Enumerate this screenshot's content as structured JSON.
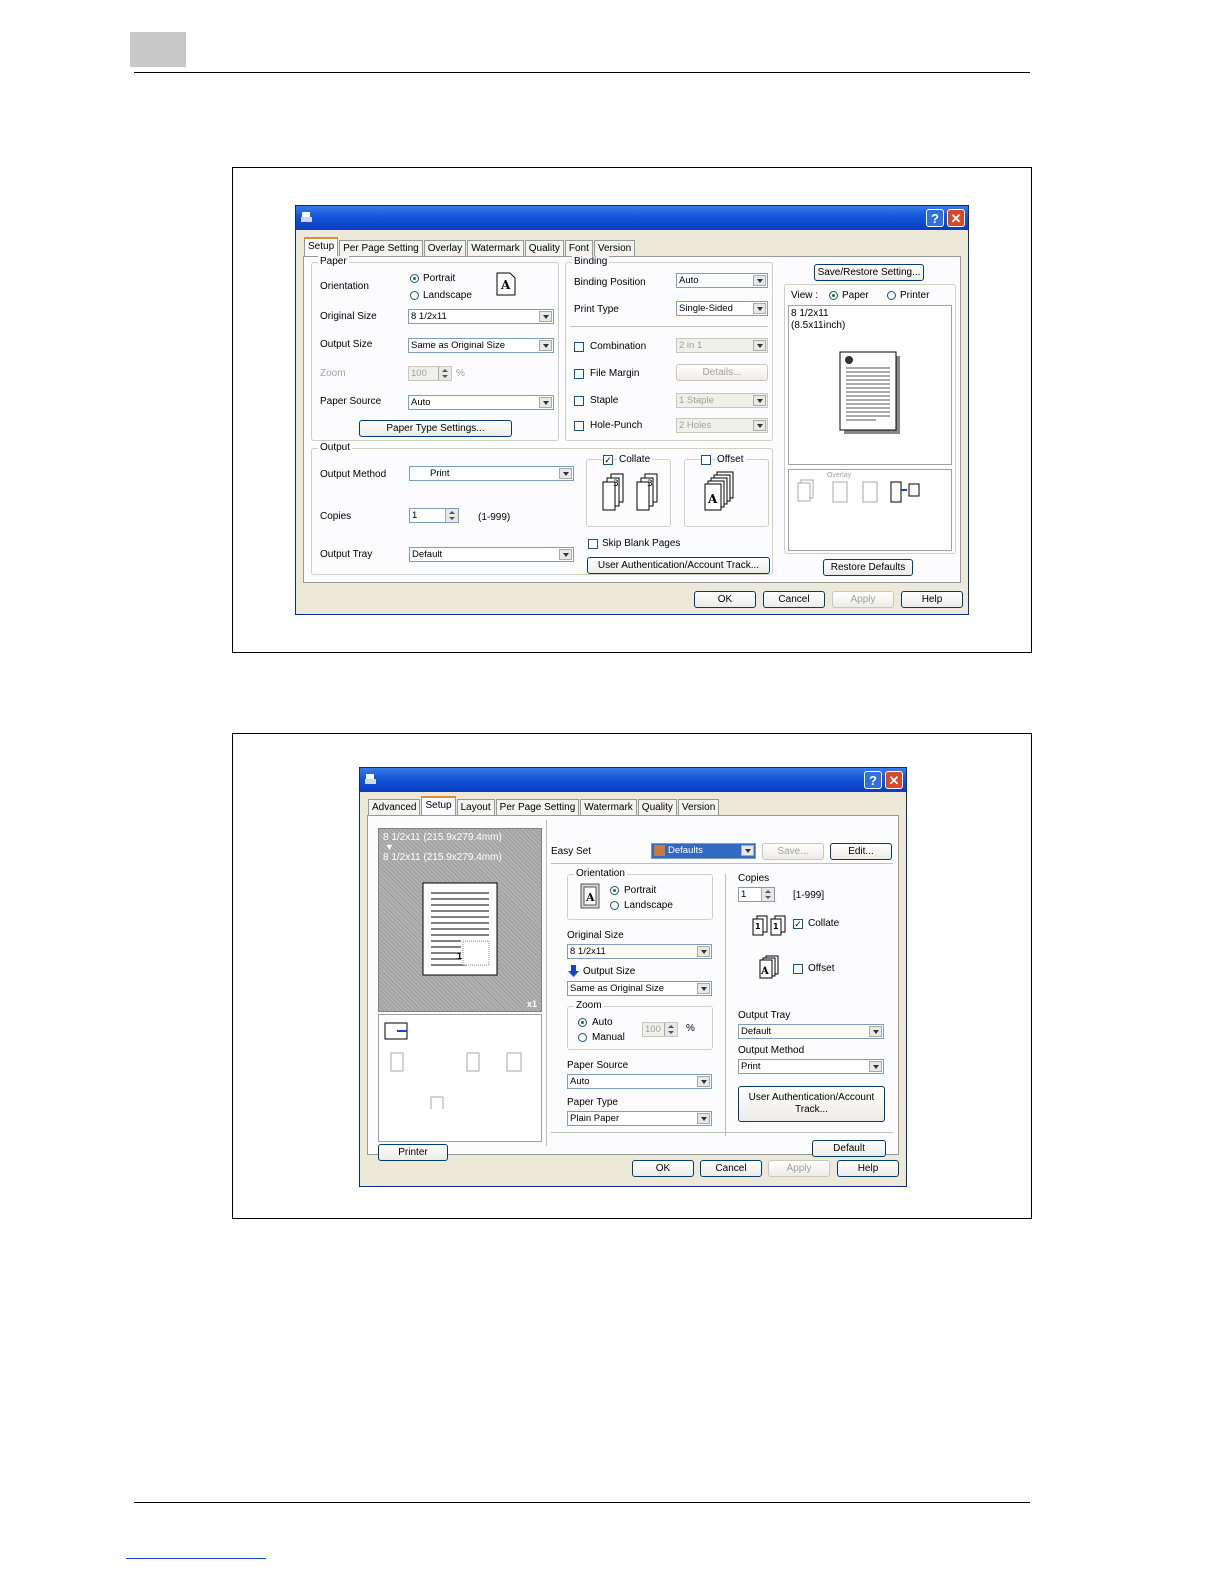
{
  "dialog1": {
    "tabs": [
      "Setup",
      "Per Page Setting",
      "Overlay",
      "Watermark",
      "Quality",
      "Font",
      "Version"
    ],
    "active_tab": "Setup",
    "paper": {
      "group_label": "Paper",
      "orientation_label": "Orientation",
      "portrait": "Portrait",
      "landscape": "Landscape",
      "original_size_label": "Original Size",
      "original_size_value": "8 1/2x11",
      "output_size_label": "Output Size",
      "output_size_value": "Same as Original Size",
      "zoom_label": "Zoom",
      "zoom_value": "100",
      "zoom_unit": "%",
      "paper_source_label": "Paper Source",
      "paper_source_value": "Auto",
      "paper_type_button": "Paper Type Settings..."
    },
    "binding": {
      "group_label": "Binding",
      "binding_position_label": "Binding Position",
      "binding_position_value": "Auto",
      "print_type_label": "Print Type",
      "print_type_value": "Single-Sided",
      "combination_label": "Combination",
      "combination_value": "2 in 1",
      "file_margin_label": "File Margin",
      "details_button": "Details...",
      "staple_label": "Staple",
      "staple_value": "1 Staple",
      "hole_punch_label": "Hole-Punch",
      "hole_punch_value": "2 Holes"
    },
    "output": {
      "group_label": "Output",
      "output_method_label": "Output Method",
      "output_method_value": "Print",
      "copies_label": "Copies",
      "copies_value": "1",
      "copies_range": "(1-999)",
      "output_tray_label": "Output Tray",
      "output_tray_value": "Default",
      "collate_label": "Collate",
      "offset_label": "Offset",
      "skip_blank_label": "Skip Blank Pages",
      "user_auth_button": "User Authentication/Account Track..."
    },
    "right": {
      "save_restore_button": "Save/Restore Setting...",
      "view_label": "View :",
      "view_paper": "Paper",
      "view_printer": "Printer",
      "preview_size": "8 1/2x11",
      "preview_inch": "(8.5x11inch)",
      "overlay_caption": "Overlay",
      "restore_defaults_button": "Restore Defaults"
    },
    "buttons": {
      "ok": "OK",
      "cancel": "Cancel",
      "apply": "Apply",
      "help": "Help"
    }
  },
  "dialog2": {
    "tabs": [
      "Advanced",
      "Setup",
      "Layout",
      "Per Page Setting",
      "Watermark",
      "Quality",
      "Version"
    ],
    "active_tab": "Setup",
    "preview_line1": "8 1/2x11 (215.9x279.4mm)",
    "preview_arrow": "▼",
    "preview_line2": "8 1/2x11 (215.9x279.4mm)",
    "preview_count": "x1",
    "preview_page_no": "1",
    "printer_button": "Printer",
    "easy_set_label": "Easy Set",
    "easy_set_value": "Defaults",
    "save_button": "Save...",
    "edit_button": "Edit...",
    "orientation_label": "Orientation",
    "portrait": "Portrait",
    "landscape": "Landscape",
    "original_size_label": "Original Size",
    "original_size_value": "8 1/2x11",
    "output_size_label": "Output Size",
    "output_size_value": "Same as Original Size",
    "zoom_label": "Zoom",
    "zoom_auto": "Auto",
    "zoom_manual": "Manual",
    "zoom_value": "100",
    "zoom_unit": "%",
    "paper_source_label": "Paper Source",
    "paper_source_value": "Auto",
    "paper_type_label": "Paper Type",
    "paper_type_value": "Plain Paper",
    "copies_label": "Copies",
    "copies_value": "1",
    "copies_range": "[1-999]",
    "collate_label": "Collate",
    "offset_label": "Offset",
    "output_tray_label": "Output Tray",
    "output_tray_value": "Default",
    "output_method_label": "Output Method",
    "output_method_value": "Print",
    "user_auth_line1": "User Authentication/Account",
    "user_auth_line2": "Track...",
    "default_button": "Default",
    "buttons": {
      "ok": "OK",
      "cancel": "Cancel",
      "apply": "Apply",
      "help": "Help"
    }
  }
}
